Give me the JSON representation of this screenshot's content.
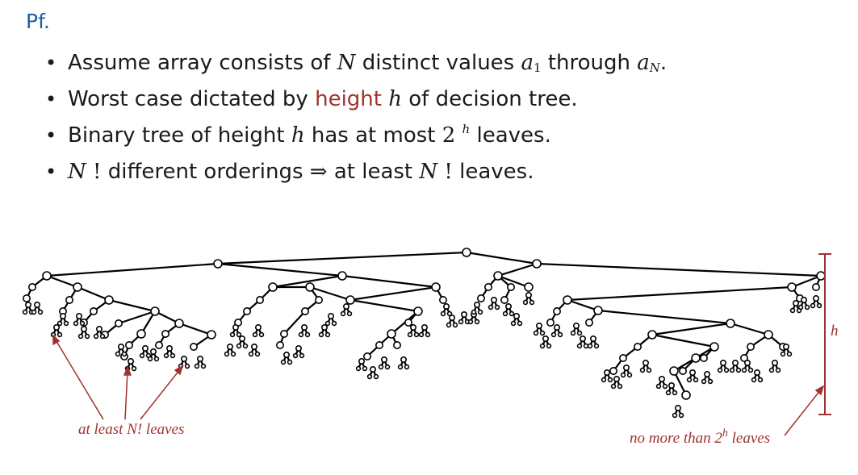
{
  "heading": "Pf.",
  "bullets": {
    "b1": {
      "text1": "Assume array consists of ",
      "N": "N",
      "text2": " distinct values ",
      "a": "a",
      "sub1": "1",
      "text3": " through ",
      "a2": "a",
      "subN": "N",
      "text4": "."
    },
    "b2": {
      "text1": "Worst case dictated by ",
      "height": "height",
      "h": "h",
      "text2": " of decision tree."
    },
    "b3": {
      "text1": "Binary tree of height ",
      "h": "h",
      "text2": " has at most ",
      "two": "2",
      "sup": "h",
      "text3": " leaves."
    },
    "b4": {
      "N": "N",
      "bang1": " !",
      "text1": " different orderings  ",
      "arrow": "⇒",
      "text2": "  at least ",
      "N2": "N",
      "bang2": " !",
      "text3": " leaves."
    }
  },
  "diagram": {
    "left_label": "at least N! leaves",
    "right_label": "no more than 2",
    "right_label_sup": "h",
    "right_label_end": " leaves",
    "height_label": "h"
  },
  "colors": {
    "heading": "#1f5fa3",
    "accent": "#a0322d",
    "text": "#1a1a1a"
  }
}
